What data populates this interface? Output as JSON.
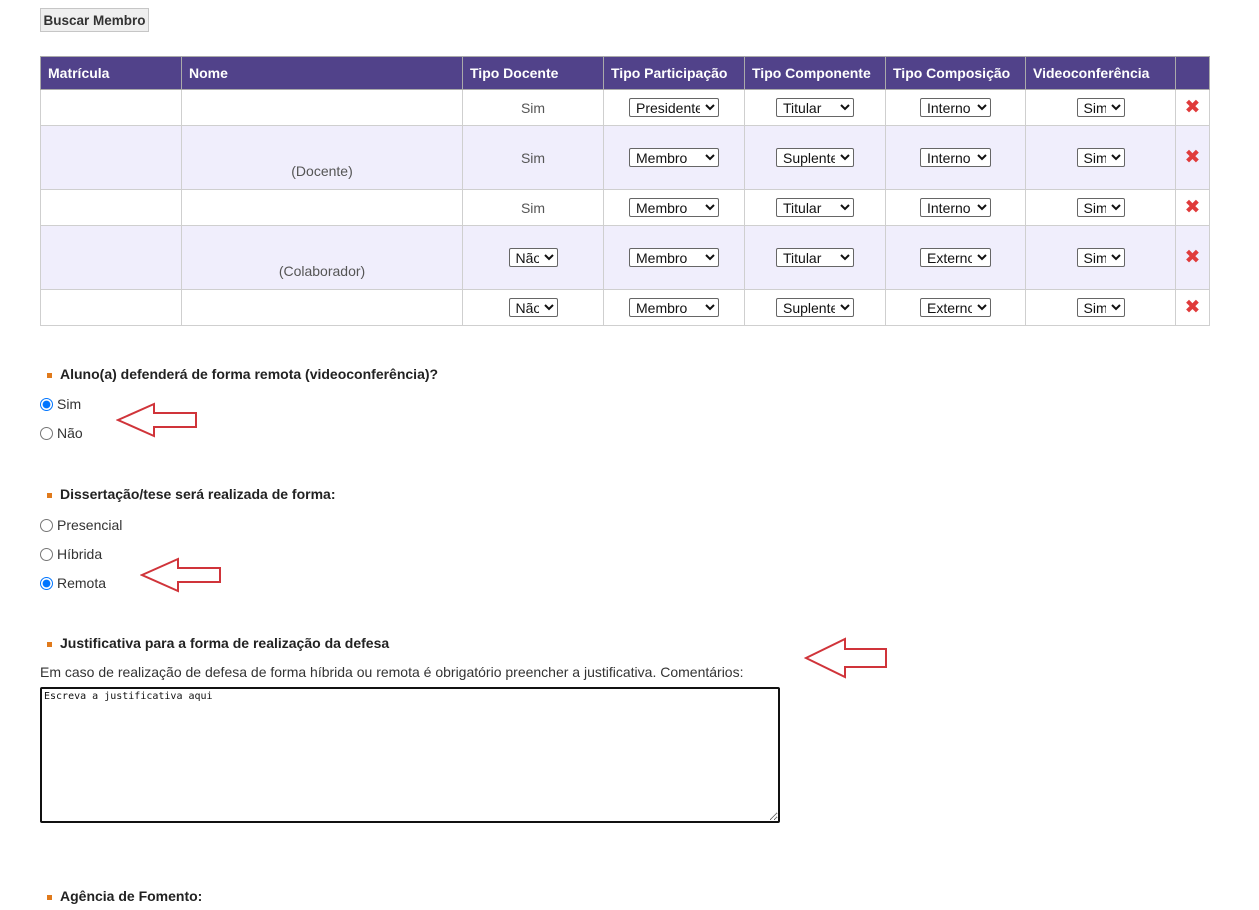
{
  "search_button": "Buscar Membro",
  "table": {
    "headers": [
      "Matrícula",
      "Nome",
      "Tipo Docente",
      "Tipo Participação",
      "Tipo Componente",
      "Tipo Composição",
      "Videoconferência",
      ""
    ],
    "rows": [
      {
        "matricula": "",
        "nome": "",
        "nome_sub": "",
        "tipo_docente": "Sim",
        "tipo_docente_select": false,
        "participacao": "Presidente",
        "componente": "Titular",
        "composicao": "Interno",
        "video": "Sim"
      },
      {
        "matricula": "",
        "nome": "",
        "nome_sub": "(Docente)",
        "tipo_docente": "Sim",
        "tipo_docente_select": false,
        "participacao": "Membro",
        "componente": "Suplente",
        "composicao": "Interno",
        "video": "Sim"
      },
      {
        "matricula": "",
        "nome": "",
        "nome_sub": "",
        "tipo_docente": "Sim",
        "tipo_docente_select": false,
        "participacao": "Membro",
        "componente": "Titular",
        "composicao": "Interno",
        "video": "Sim"
      },
      {
        "matricula": "",
        "nome": "",
        "nome_sub": "(Colaborador)",
        "tipo_docente": "Não",
        "tipo_docente_select": true,
        "participacao": "Membro",
        "componente": "Titular",
        "composicao": "Externo",
        "video": "Sim"
      },
      {
        "matricula": "",
        "nome": "",
        "nome_sub": "",
        "tipo_docente": "Não",
        "tipo_docente_select": true,
        "participacao": "Membro",
        "componente": "Suplente",
        "composicao": "Externo",
        "video": "Sim"
      }
    ]
  },
  "remote_question": {
    "title": "Aluno(a) defenderá de forma remota (videoconferência)?",
    "options": [
      "Sim",
      "Não"
    ],
    "selected": "Sim"
  },
  "format_question": {
    "title": "Dissertação/tese será realizada de forma:",
    "options": [
      "Presencial",
      "Híbrida",
      "Remota"
    ],
    "selected": "Remota"
  },
  "justification": {
    "title": "Justificativa para a forma de realização da defesa",
    "description": "Em caso de realização de defesa de forma híbrida ou remota é obrigatório preencher a justificativa. Comentários:",
    "value": "Escreva a justificativa aqui"
  },
  "agency": {
    "title": "Agência de Fomento:"
  },
  "colors": {
    "header_bg": "#51428a",
    "bullet": "#e07a1c",
    "delete": "#e03b3b",
    "arrow": "#d0343a",
    "alt_row": "#f0eefc"
  }
}
